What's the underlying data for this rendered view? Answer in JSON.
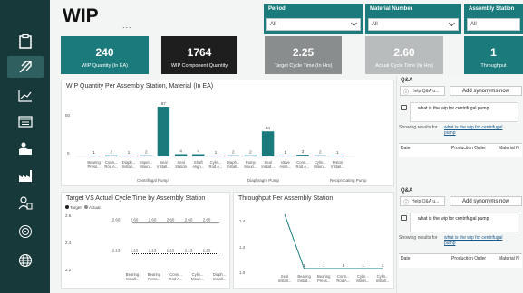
{
  "page": {
    "title": "WIP",
    "more": "..."
  },
  "sidebar": {
    "items": [
      {
        "icon": "clipboard-icon",
        "active": false
      },
      {
        "icon": "feather-icon",
        "active": true
      },
      {
        "icon": "line-chart-icon",
        "active": false
      },
      {
        "icon": "calendar-icon",
        "active": false
      },
      {
        "icon": "worker-icon",
        "active": false
      },
      {
        "icon": "factory-icon",
        "active": false
      },
      {
        "icon": "people-icon",
        "active": false
      },
      {
        "icon": "target-icon",
        "active": false
      },
      {
        "icon": "globe-icon",
        "active": false
      }
    ]
  },
  "filters": [
    {
      "label": "Period",
      "value": "All"
    },
    {
      "label": "Material Number",
      "value": "All"
    },
    {
      "label": "Assembly Station",
      "value": "All"
    }
  ],
  "kpis": [
    {
      "value": "240",
      "label": "WIP Quantity (In EA)"
    },
    {
      "value": "1764",
      "label": "WIP Component Quantity"
    },
    {
      "value": "2.25",
      "label": "Target Cycle Time (In Hrs)"
    },
    {
      "value": "2.60",
      "label": "Actual Cycle Time (In Hrs)"
    },
    {
      "value": "1",
      "label": "Throughput"
    }
  ],
  "colors": {
    "teal": "#1b7b7c",
    "dark": "#18393a",
    "black": "#1e1e1e",
    "gray": "#8a8d8d"
  },
  "wip_chart": {
    "title": "WIP Quantity Per Assembly Station, Material (In EA)",
    "y_ticks": [
      "50",
      "0"
    ],
    "groups": [
      "Centrifugal Pump",
      "Diaphragm Pump",
      "Reciprocating Pump"
    ],
    "chart_data": {
      "type": "bar",
      "categories": [
        "Bearing Press...",
        "Conn... Rod A...",
        "Diaph... Install...",
        "Impel... Moun...",
        "Seal Install...",
        "Seal Station",
        "Shaft Align...",
        "Cylin... Rod A...",
        "Diaph... Install...",
        "Pump Moun...",
        "Seal Install...",
        "Valve Asse...",
        "Conn... Rod A...",
        "Cylin... Moun...",
        "Piston Install..."
      ],
      "values": [
        1,
        2,
        1,
        2,
        87,
        4,
        4,
        1,
        2,
        2,
        44,
        1,
        3,
        2,
        1
      ],
      "ylim": [
        0,
        95
      ]
    }
  },
  "cycle_chart": {
    "title": "Target VS Actual Cycle Time by Assembly Station",
    "legend": [
      "Target",
      "Actual"
    ],
    "y_ticks": [
      "2.6",
      "2.4",
      "2.2"
    ],
    "chart_data": {
      "type": "line",
      "categories": [
        "Bearing Install...",
        "Bearing Press...",
        "Conn... Rod A...",
        "Cylin... Moun...",
        "Diaph... Install..."
      ],
      "series": [
        {
          "name": "Actual",
          "values": [
            2.6,
            2.6,
            2.6,
            2.6,
            2.6
          ]
        },
        {
          "name": "Target",
          "values": [
            2.25,
            2.25,
            2.25,
            2.25,
            2.25
          ]
        }
      ],
      "value_labels": {
        "Actual": [
          "2.60",
          "2.60",
          "2.60",
          "2.60",
          "2.60",
          "2.60"
        ],
        "Target": [
          "2.25",
          "2.25",
          "2.25",
          "2.25",
          "2.25",
          "2.25"
        ]
      }
    }
  },
  "throughput_chart": {
    "title": "Throughput Per Assembly Station",
    "y_ticks": [
      "1.4",
      "1.2",
      "1.0"
    ],
    "chart_data": {
      "type": "line",
      "categories": [
        "Seal Install...",
        "Bearing Install...",
        "Bearing Press...",
        "Conn... Rod A...",
        "Cylin... Moun...",
        "Cylin... Install..."
      ],
      "values": [
        1.5,
        1.0,
        1.0,
        1.0,
        1.0,
        1.0
      ],
      "point_labels": [
        "",
        "1",
        "1",
        "1",
        "1",
        "1"
      ]
    }
  },
  "qa_panels": [
    {
      "title": "Q&A",
      "dropdown": "Help Q&A u...",
      "synonyms_button": "Add synonyms now",
      "question": "what is the wip for centrifugal pump",
      "showing": "Showing results for",
      "result_link": "what is the wip for centrifugal pump",
      "table_headers": [
        "Date",
        "Production Order",
        "Material N"
      ]
    },
    {
      "title": "Q&A",
      "dropdown": "Help Q&A u...",
      "synonyms_button": "Add synonyms now",
      "question": "what is the wip for centrifugal pump",
      "showing": "Showing results for",
      "result_link": "what is the wip for centrifugal pump",
      "table_headers": [
        "Date",
        "Production Order",
        "Material N"
      ]
    }
  ]
}
